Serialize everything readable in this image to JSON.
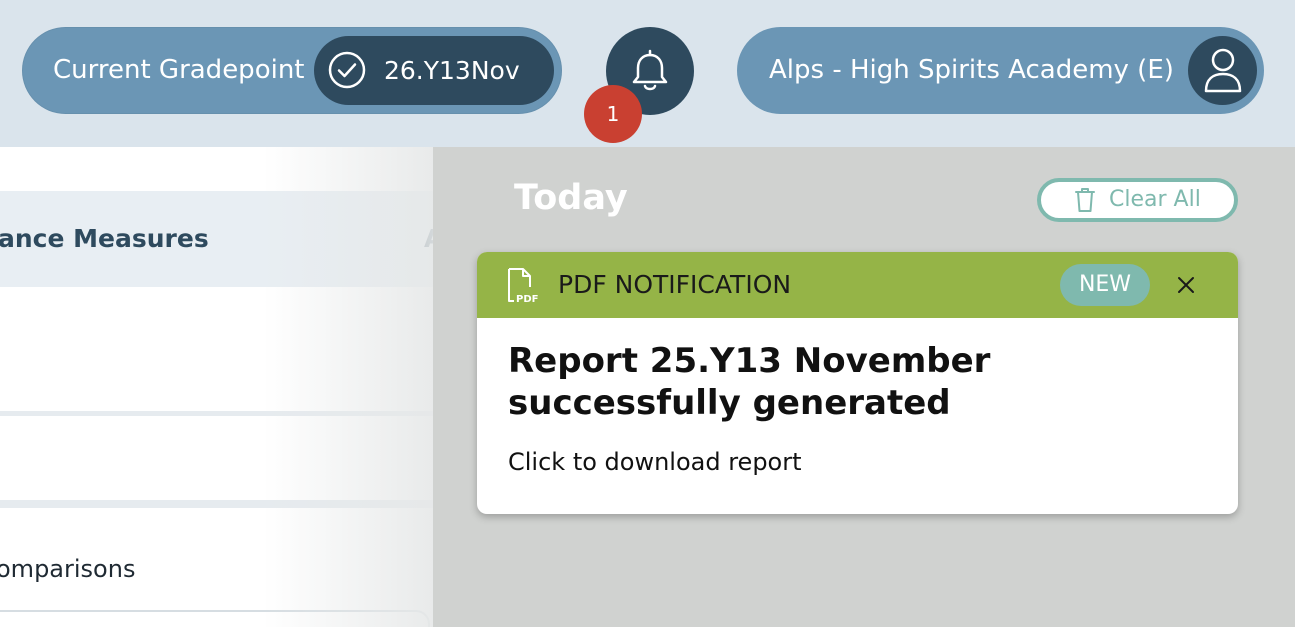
{
  "header": {
    "gradepoint_label": "Current Gradepoint",
    "gradepoint_value": "26.Y13Nov",
    "notification_count": "1",
    "school_name": "Alps - High Spirits Academy (E)"
  },
  "background_page": {
    "measures_label": "ance Measures",
    "measures_extra": "A",
    "comparisons_label": "omparisons"
  },
  "notifications": {
    "section_heading": "Today",
    "clear_all_label": "Clear All",
    "items": [
      {
        "type_label": "PDF NOTIFICATION",
        "badge": "NEW",
        "title": "Report 25.Y13 November successfully generated",
        "body": "Click to download report",
        "header_color": "#95b447"
      }
    ]
  },
  "colors": {
    "pill_blue": "#6b96b5",
    "dark_navy": "#2e4a5e",
    "badge_red": "#c94031",
    "teal": "#7fb9ae",
    "pdf_green": "#95b447"
  }
}
